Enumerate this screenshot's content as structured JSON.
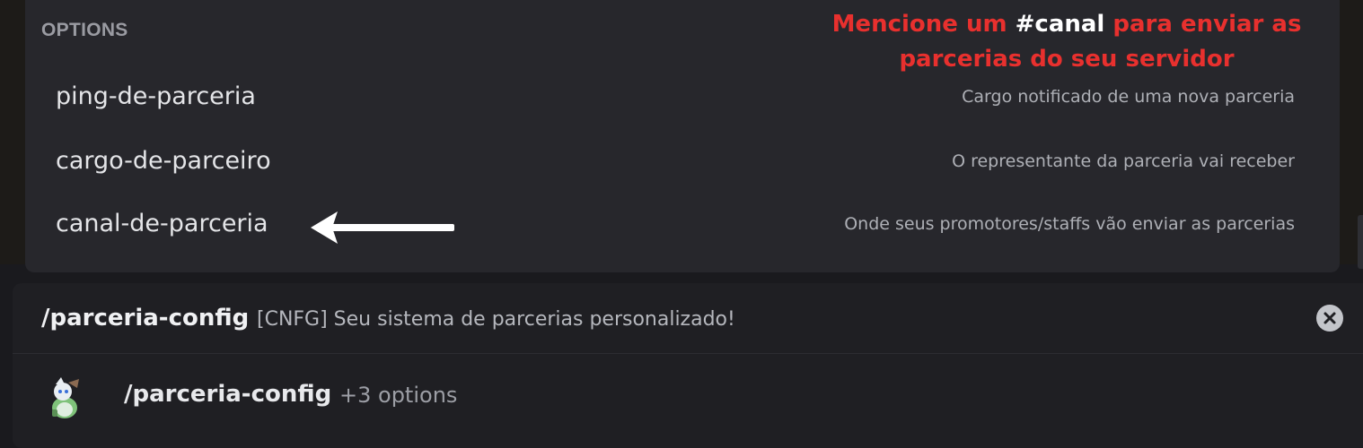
{
  "options_panel": {
    "heading": "OPTIONS",
    "annotation": {
      "line1_prefix": "Mencione um ",
      "line1_highlight": "#canal",
      "line1_suffix": " para enviar as",
      "line2": "parcerias do seu servidor"
    },
    "items": [
      {
        "name": "ping-de-parceria",
        "description": "Cargo notificado de uma nova parceria"
      },
      {
        "name": "cargo-de-parceiro",
        "description": "O representante da parceria vai receber"
      },
      {
        "name": "canal-de-parceria",
        "description": "Onde seus promotores/staffs vão enviar as parcerias"
      }
    ]
  },
  "command_panel": {
    "title": "/parceria-config",
    "subtitle": "[CNFG] Seu sistema de parcerias personalizado!",
    "suggestion": {
      "command": "/parceria-config",
      "options_count": "+3 options"
    }
  },
  "icons": {
    "close": "close-circle-icon",
    "arrow": "arrow-left-icon",
    "avatar": "bot-avatar"
  },
  "colors": {
    "annotation_red": "#e8302e",
    "panel_bg": "#27272c",
    "command_bg": "#1f1f23"
  }
}
